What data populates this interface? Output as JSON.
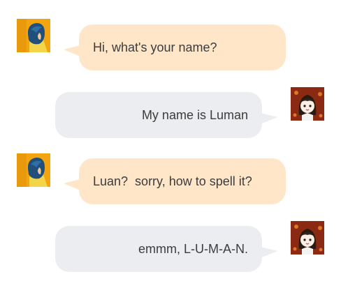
{
  "messages": [
    {
      "side": "left",
      "avatar": "girl-blue-hair-avatar",
      "text": "Hi, what's your name?"
    },
    {
      "side": "right",
      "avatar": "cartoon-girl-avatar",
      "text": "My name is Luman"
    },
    {
      "side": "left",
      "avatar": "girl-blue-hair-avatar",
      "text": "Luan?  sorry, how to spell it?"
    },
    {
      "side": "right",
      "avatar": "cartoon-girl-avatar",
      "text": "emmm, L-U-M-A-N."
    }
  ],
  "colors": {
    "left_bubble": "#ffe6c9",
    "right_bubble": "#ebedf0",
    "text": "#3c3c3c"
  }
}
